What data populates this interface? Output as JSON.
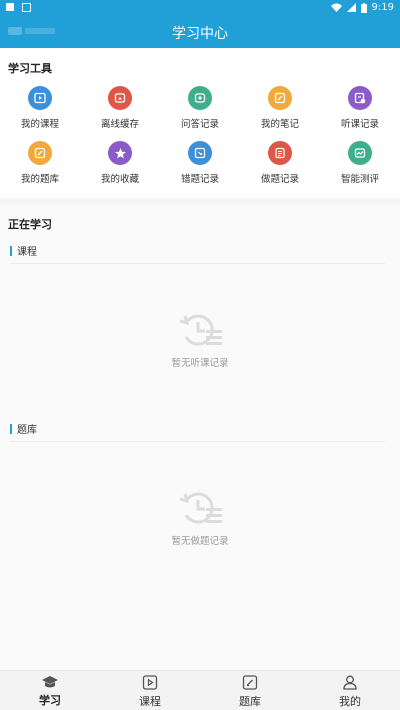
{
  "status": {
    "time": "9:19"
  },
  "header": {
    "title": "学习中心"
  },
  "tools": {
    "title": "学习工具",
    "items": [
      {
        "label": "我的课程",
        "icon": "play-icon",
        "color": "#3d8fd9"
      },
      {
        "label": "离线缓存",
        "icon": "download-cloud-icon",
        "color": "#e0574a"
      },
      {
        "label": "问答记录",
        "icon": "qa-icon",
        "color": "#3faf8b"
      },
      {
        "label": "我的笔记",
        "icon": "note-edit-icon",
        "color": "#f0a93a"
      },
      {
        "label": "听课记录",
        "icon": "lecture-record-icon",
        "color": "#8a5cc9"
      },
      {
        "label": "我的题库",
        "icon": "question-bank-icon",
        "color": "#f0a93a"
      },
      {
        "label": "我的收藏",
        "icon": "star-icon",
        "color": "#8a5cc9"
      },
      {
        "label": "错题记录",
        "icon": "wrong-question-icon",
        "color": "#3d8fd9"
      },
      {
        "label": "做题记录",
        "icon": "practice-record-icon",
        "color": "#e0574a"
      },
      {
        "label": "智能测评",
        "icon": "assessment-icon",
        "color": "#3faf8b"
      }
    ]
  },
  "learning": {
    "title": "正在学习",
    "courses_header": "课程",
    "courses_empty": "暂无听课记录",
    "questions_header": "题库",
    "questions_empty": "暂无做题记录"
  },
  "nav": {
    "items": [
      {
        "label": "学习",
        "icon": "graduation-cap-icon",
        "active": true
      },
      {
        "label": "课程",
        "icon": "play-square-icon",
        "active": false
      },
      {
        "label": "题库",
        "icon": "edit-square-icon",
        "active": false
      },
      {
        "label": "我的",
        "icon": "person-icon",
        "active": false
      }
    ]
  },
  "colors": {
    "primary": "#21a0d8"
  }
}
